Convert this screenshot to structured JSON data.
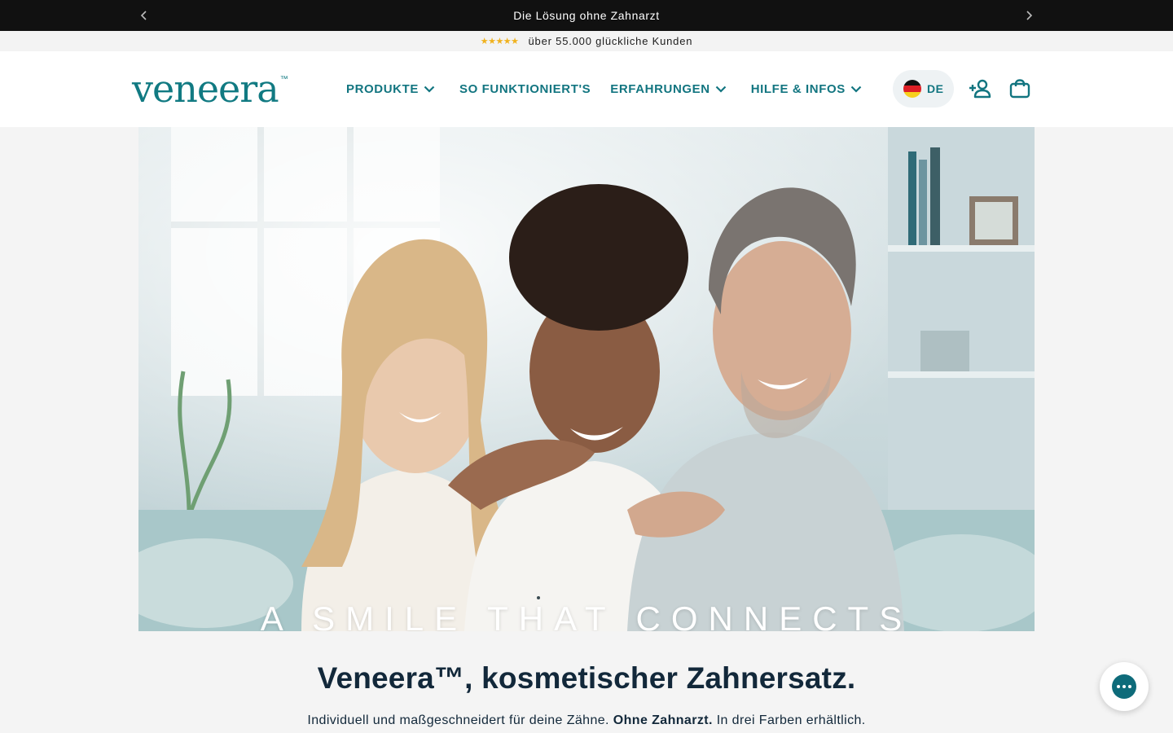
{
  "announcement": {
    "text": "Die Lösung ohne Zahnarzt",
    "prev_icon": "chevron-left-icon",
    "next_icon": "chevron-right-icon"
  },
  "rating_bar": {
    "stars": "★★★★★",
    "text": "über 55.000 glückliche Kunden",
    "star_color": "#f0b21f"
  },
  "header": {
    "logo": "veneera",
    "logo_mark": "™",
    "nav": [
      {
        "label": "PRODUKTE",
        "has_dropdown": true
      },
      {
        "label": "SO FUNKTIONIERT'S",
        "has_dropdown": false
      },
      {
        "label": "ERFAHRUNGEN",
        "has_dropdown": true
      },
      {
        "label": "HILFE & INFOS",
        "has_dropdown": true
      }
    ],
    "language": "DE",
    "account_icon": "add-user-icon",
    "cart_icon": "shopping-bag-icon",
    "brand_color": "#127580"
  },
  "hero": {
    "overlay_text": "A SMILE THAT CONNECTS"
  },
  "intro": {
    "headline": "Veneera™, kosmetischer Zahnersatz.",
    "subline_start": "Individuell und maßgeschneidert für deine Zähne.",
    "subline_bold": "Ohne Zahnarzt.",
    "subline_end": "In drei Farben erhältlich."
  },
  "chat": {
    "icon": "chat-bubble-icon",
    "color": "#0e6b7a"
  }
}
